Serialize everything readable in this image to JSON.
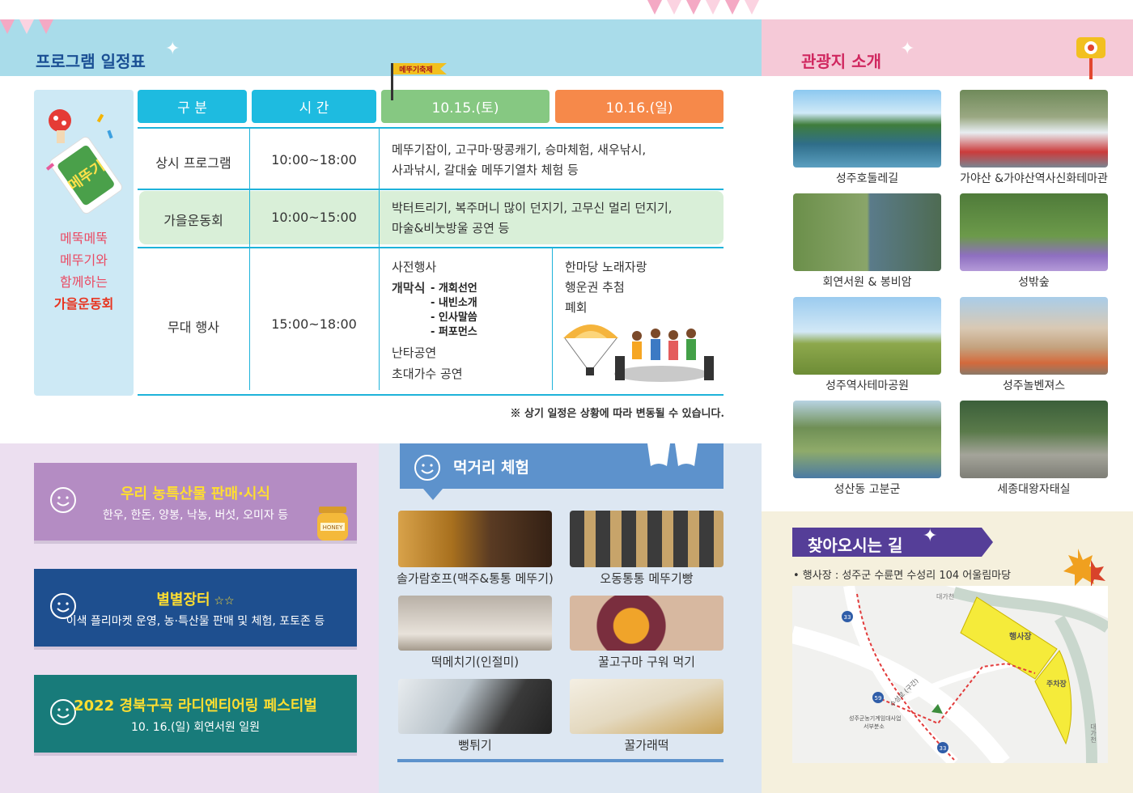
{
  "schedule": {
    "title": "프로그램 일정표",
    "mascot_label": "메뚜기",
    "side_line1": "메뚝메뚝",
    "side_line2": "메뚜기와",
    "side_line3": "함께하는",
    "side_line4": "가을운동회",
    "flag_label": "메뚜기축제",
    "headers": {
      "category": "구 분",
      "time": "시 간",
      "day1": "10.15.(토)",
      "day2": "10.16.(일)"
    },
    "rows": [
      {
        "category": "상시 프로그램",
        "time": "10:00~18:00",
        "line1": "메뚜기잡이, 고구마·땅콩캐기, 승마체험, 새우낚시,",
        "line2": "사과낚시, 갈대숲 메뚜기열차 체험 등"
      },
      {
        "category": "가을운동회",
        "time": "10:00~15:00",
        "line1": "박터트리기, 복주머니 많이 던지기, 고무신 멀리 던지기,",
        "line2": "마술&비눗방울 공연 등"
      },
      {
        "category": "무대 행사",
        "time": "15:00~18:00"
      }
    ],
    "stage_day1": {
      "pre": "사전행사",
      "opening": "개막식",
      "opening_items": [
        "- 개회선언",
        "- 내빈소개",
        "- 인사말씀",
        "- 퍼포먼스"
      ],
      "after1": "난타공연",
      "after2": "초대가수 공연"
    },
    "stage_day2": [
      "한마당 노래자랑",
      "행운권 추첨",
      "폐회"
    ],
    "note": "※ 상기 일정은 상황에 따라 변동될 수 있습니다."
  },
  "boxes": [
    {
      "title": "우리 농특산물 판매·시식",
      "sub": "한우, 한돈, 양봉, 낙농, 버섯, 오미자 등",
      "color": "#b48cc3"
    },
    {
      "title": "별별장터",
      "sub": "이색 플리마켓 운영, 농·특산물 판매 및 체험, 포토존 등",
      "color": "#1e4f8f"
    },
    {
      "title": "2022 경북구곡 라디엔티어링 페스티벌",
      "sub": "10. 16.(일) 회연서원 일원",
      "color": "#187b7a"
    }
  ],
  "honey_label": "HONEY",
  "food": {
    "title": "먹거리 체험",
    "items": [
      "솔가람호프(맥주&통통 메뚜기)",
      "오동통통 메뚜기빵",
      "떡메치기(인절미)",
      "꿀고구마 구워 먹기",
      "뻥튀기",
      "꿀가래떡"
    ]
  },
  "tour": {
    "title": "관광지 소개",
    "items": [
      "성주호둘레길",
      "가야산 &가야산역사신화테마관",
      "회연서원 & 봉비암",
      "성밖숲",
      "성주역사테마공원",
      "성주놀벤져스",
      "성산동 고분군",
      "세종대왕자태실"
    ]
  },
  "directions": {
    "title": "찾아오시는 길",
    "address": "• 행사장 : 성주군 수륜면 수성리 104 어울림마당",
    "map_venue": "행사장",
    "map_parking": "주차장",
    "map_river_top": "대가천",
    "map_river_right": "대가천",
    "map_road": "수성로 (구간)",
    "map_building_line1": "성주군농기계임대사업",
    "map_building_line2": "서부분소",
    "route_33": "33",
    "route_59": "59",
    "route_33b": "33"
  }
}
